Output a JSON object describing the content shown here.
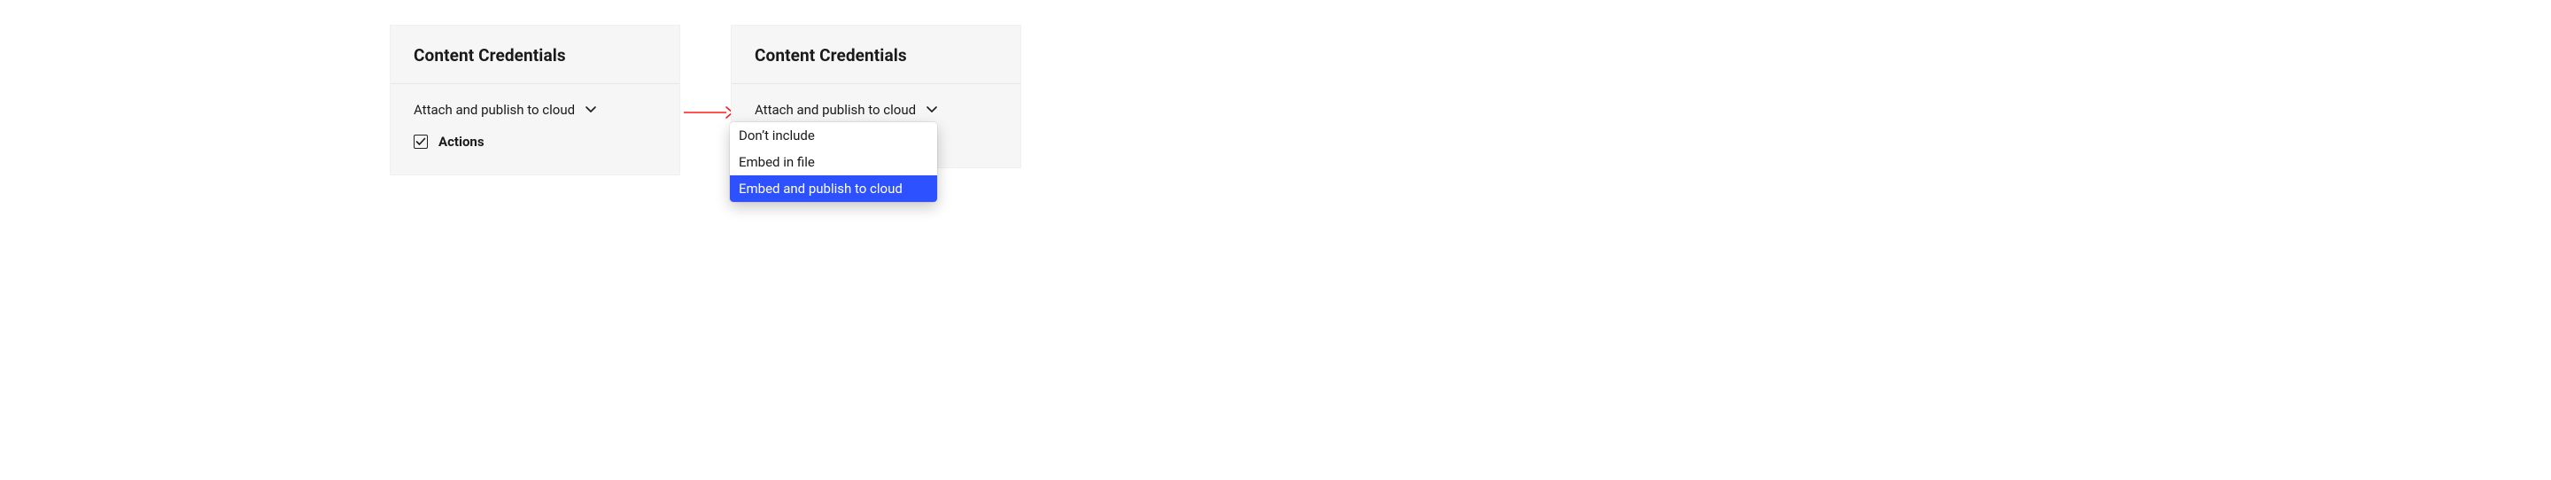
{
  "leftPanel": {
    "title": "Content Credentials",
    "select": {
      "label": "Attach and publish to cloud"
    },
    "checkbox": {
      "checked": true,
      "label": "Actions"
    }
  },
  "rightPanel": {
    "title": "Content Credentials",
    "select": {
      "label": "Attach and publish to cloud"
    },
    "dropdown": {
      "items": [
        {
          "label": "Don’t include",
          "selected": false
        },
        {
          "label": "Embed in file",
          "selected": false
        },
        {
          "label": "Embed and publish to cloud",
          "selected": true
        }
      ]
    }
  },
  "colors": {
    "panelBg": "#f6f6f6",
    "highlight": "#2d51ff",
    "arrow": "#ff1a1a"
  }
}
